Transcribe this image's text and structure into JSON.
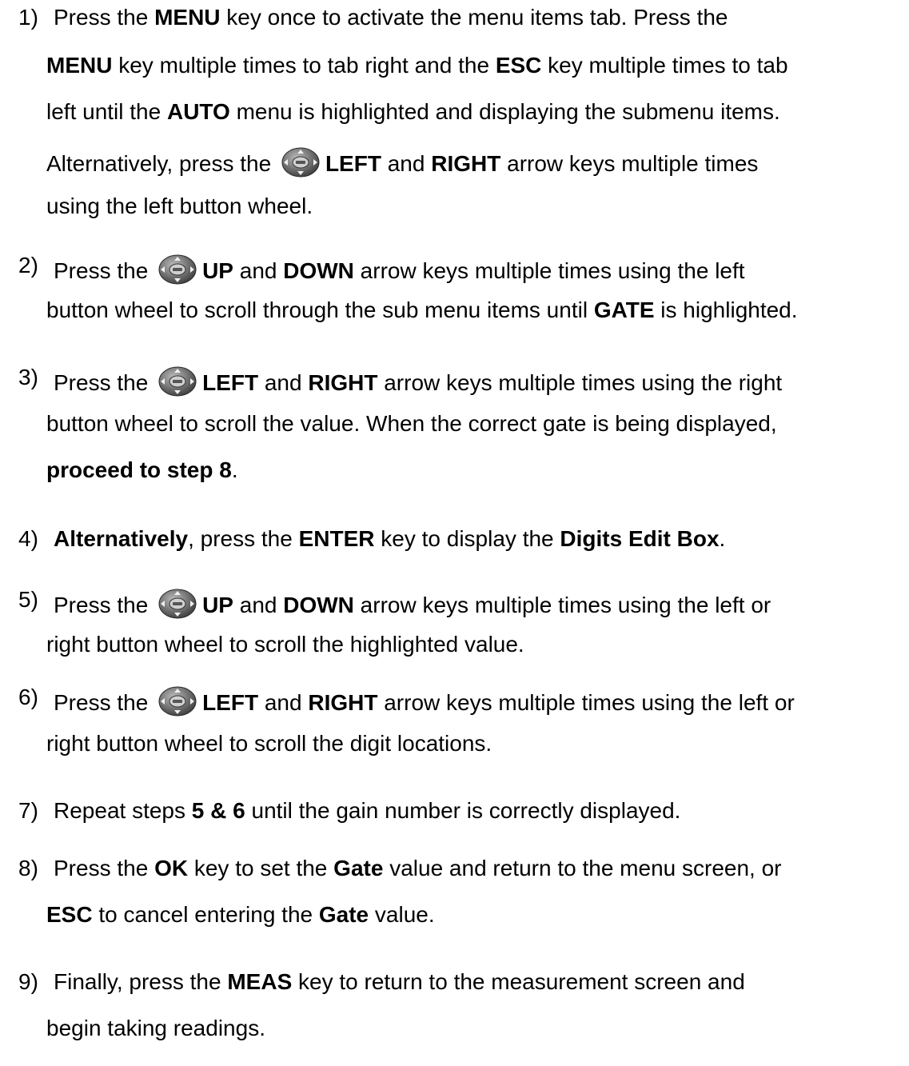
{
  "icons": {
    "wheel": "enter-button-wheel-icon"
  },
  "steps": [
    {
      "number": "1)",
      "lines": [
        [
          "Press the ",
          {
            "b": "MENU"
          },
          " key once to activate the menu items tab.  Press the"
        ],
        [
          {
            "b": "MENU"
          },
          " key multiple times to tab right and the ",
          {
            "b": "ESC"
          },
          " key multiple times to tab"
        ],
        [
          "left until the ",
          {
            "b": "AUTO"
          },
          " menu is highlighted and displaying the submenu items."
        ],
        [
          "Alternatively, press the ",
          {
            "icon": "wheel"
          },
          {
            "b": "LEFT"
          },
          " and ",
          {
            "b": "RIGHT"
          },
          " arrow keys multiple times"
        ],
        [
          "using the left button wheel."
        ]
      ]
    },
    {
      "number": "2)",
      "lines": [
        [
          "Press the ",
          {
            "icon": "wheel"
          },
          {
            "b": "UP"
          },
          " and ",
          {
            "b": "DOWN"
          },
          " arrow keys multiple times using the left"
        ],
        [
          "button wheel to scroll through the sub menu items until ",
          {
            "b": "GATE"
          },
          " is highlighted."
        ]
      ]
    },
    {
      "number": "3)",
      "lines": [
        [
          "Press the ",
          {
            "icon": "wheel"
          },
          {
            "b": "LEFT"
          },
          " and ",
          {
            "b": "RIGHT"
          },
          " arrow keys multiple times using the right"
        ],
        [
          "button wheel to scroll the value.  When the correct gate is being displayed,"
        ],
        [
          {
            "b": "proceed to step 8"
          },
          "."
        ]
      ]
    },
    {
      "number": "4)",
      "lines": [
        [
          {
            "b": "Alternatively"
          },
          ", press the ",
          {
            "b": "ENTER"
          },
          " key to display the ",
          {
            "b": "Digits Edit Box"
          },
          "."
        ]
      ]
    },
    {
      "number": "5)",
      "lines": [
        [
          "Press the ",
          {
            "icon": "wheel"
          },
          {
            "b": "UP"
          },
          " and ",
          {
            "b": "DOWN"
          },
          " arrow keys multiple times using the left or"
        ],
        [
          "right button wheel to scroll the highlighted value."
        ]
      ]
    },
    {
      "number": "6)",
      "lines": [
        [
          "Press the ",
          {
            "icon": "wheel"
          },
          {
            "b": "LEFT"
          },
          " and ",
          {
            "b": "RIGHT"
          },
          " arrow keys multiple times using the left or"
        ],
        [
          "right button wheel to scroll the digit locations."
        ]
      ]
    },
    {
      "number": "7)",
      "lines": [
        [
          "Repeat steps ",
          {
            "b": "5 & 6"
          },
          " until the gain number is correctly displayed."
        ]
      ]
    },
    {
      "number": "8)",
      "lines": [
        [
          "Press the ",
          {
            "b": "OK"
          },
          " key to set the ",
          {
            "b": "Gate"
          },
          " value and return to the menu screen, or"
        ],
        [
          {
            "b": "ESC"
          },
          " to cancel entering the ",
          {
            "b": "Gate"
          },
          " value."
        ]
      ]
    },
    {
      "number": "9)",
      "lines": [
        [
          "Finally, press the ",
          {
            "b": "MEAS"
          },
          " key to return to the measurement screen and"
        ],
        [
          "begin taking readings."
        ]
      ]
    }
  ]
}
